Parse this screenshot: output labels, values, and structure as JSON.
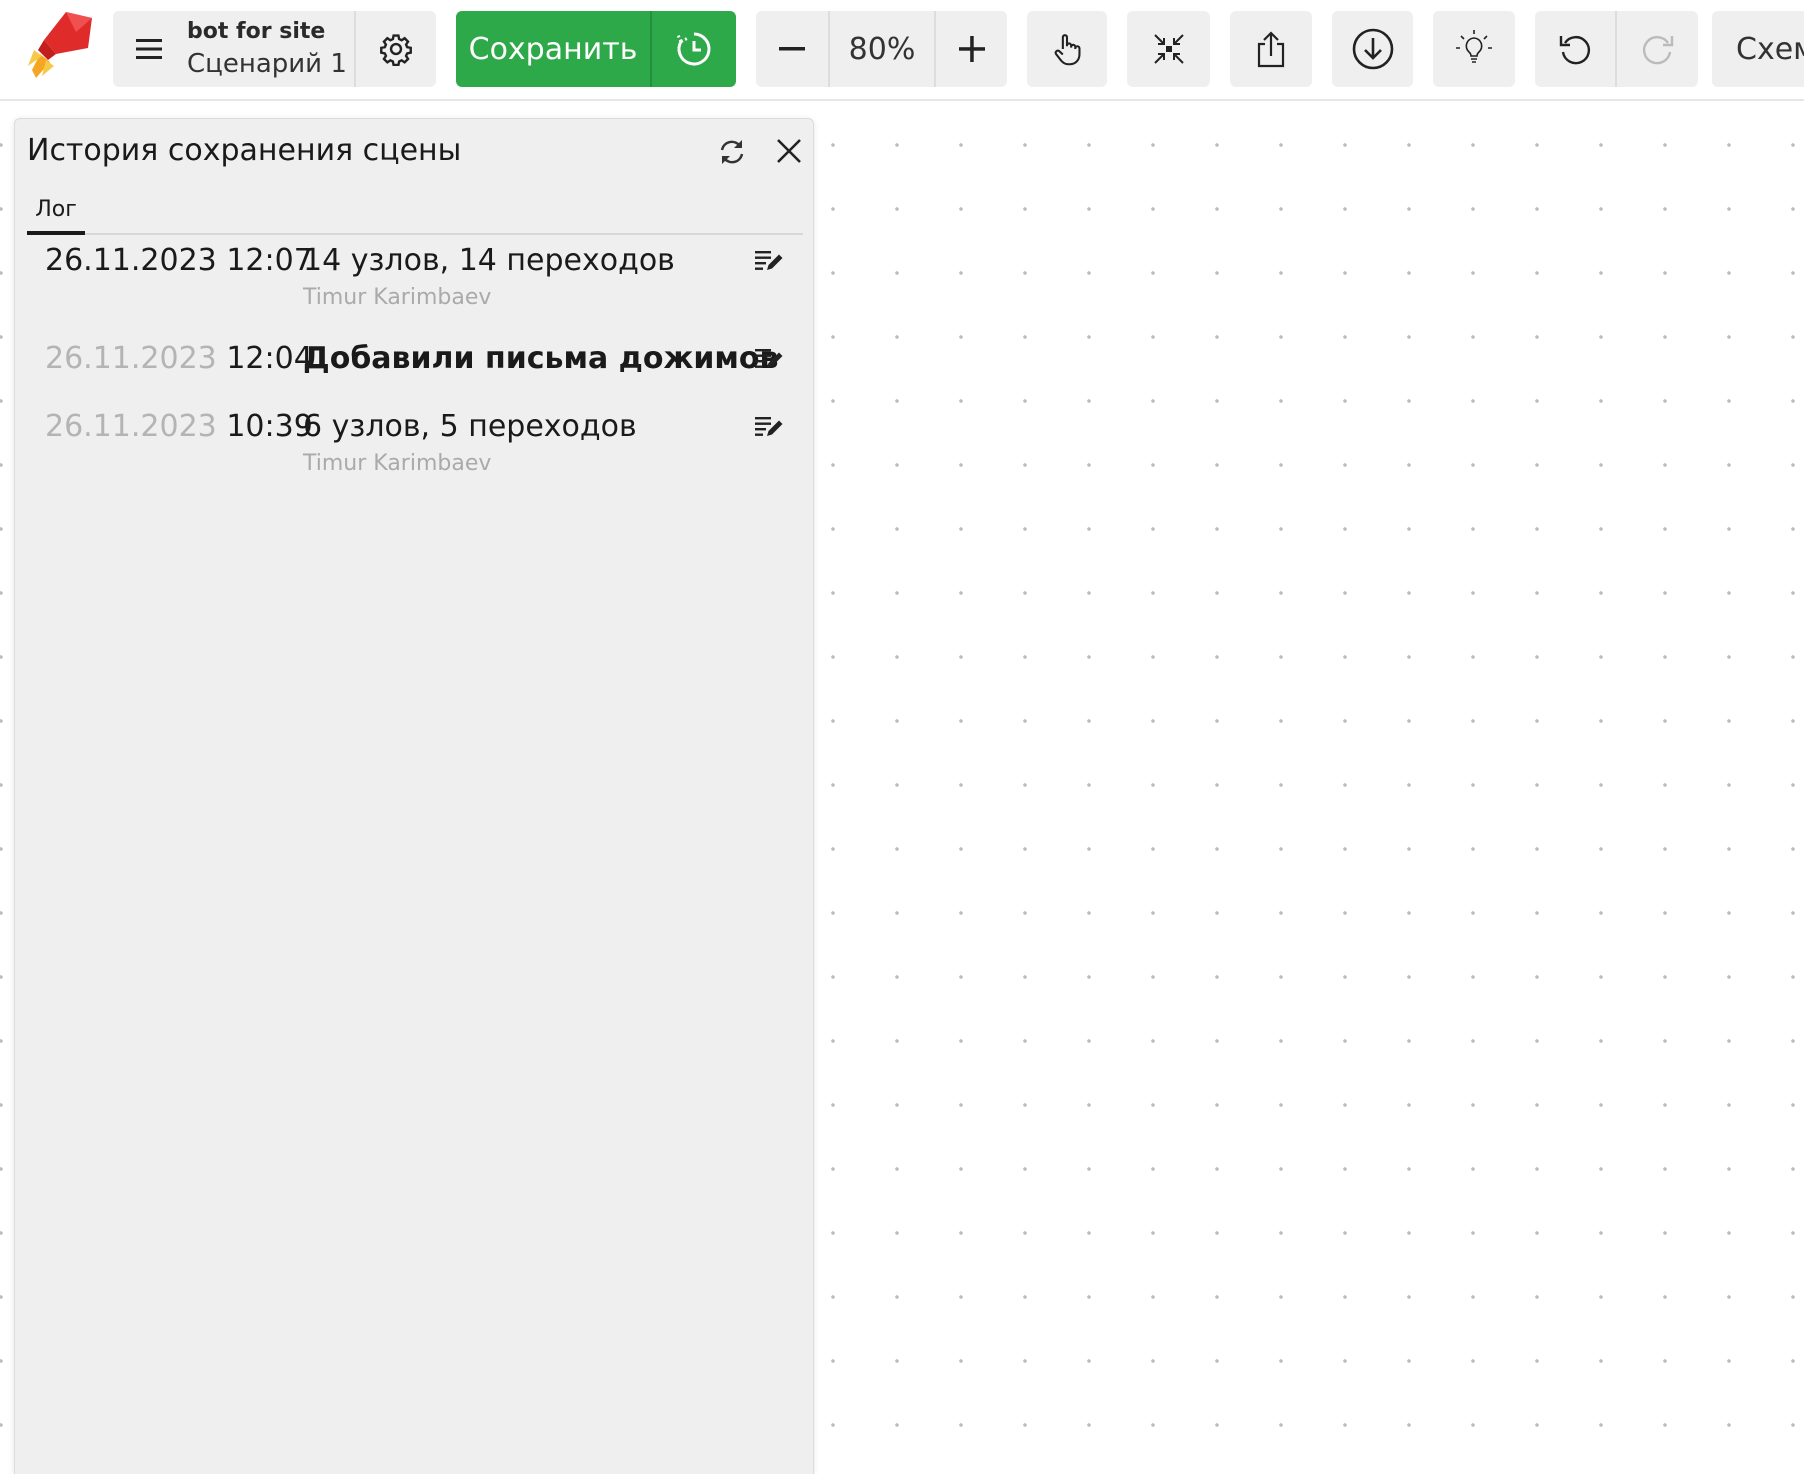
{
  "toolbar": {
    "logo_icon": "rocket-logo-icon",
    "project": {
      "name": "bot for site",
      "scenario": "Сценарий 1"
    },
    "save_label": "Сохранить",
    "zoom": {
      "value": "80%"
    },
    "schema_label": "Схем"
  },
  "history_panel": {
    "title": "История сохранения сцены",
    "tabs": [
      {
        "label": "Лог",
        "active": true
      }
    ],
    "entries": [
      {
        "date": "26.11.2023",
        "time": "12:07",
        "date_faded": false,
        "description": "14 узлов, 14 переходов",
        "bold": false,
        "author": "Timur Karimbaev"
      },
      {
        "date": "26.11.2023",
        "time": "12:04",
        "date_faded": true,
        "description": "Добавили письма дожимов",
        "bold": true,
        "author": ""
      },
      {
        "date": "26.11.2023",
        "time": "10:39",
        "date_faded": true,
        "description": "6 узлов, 5 переходов",
        "bold": false,
        "author": "Timur Karimbaev"
      }
    ]
  },
  "colors": {
    "accent_green": "#2ea94a",
    "panel_bg": "#efefef",
    "toolbar_button_bg": "#efefef",
    "muted_text": "#aaaaaa"
  }
}
